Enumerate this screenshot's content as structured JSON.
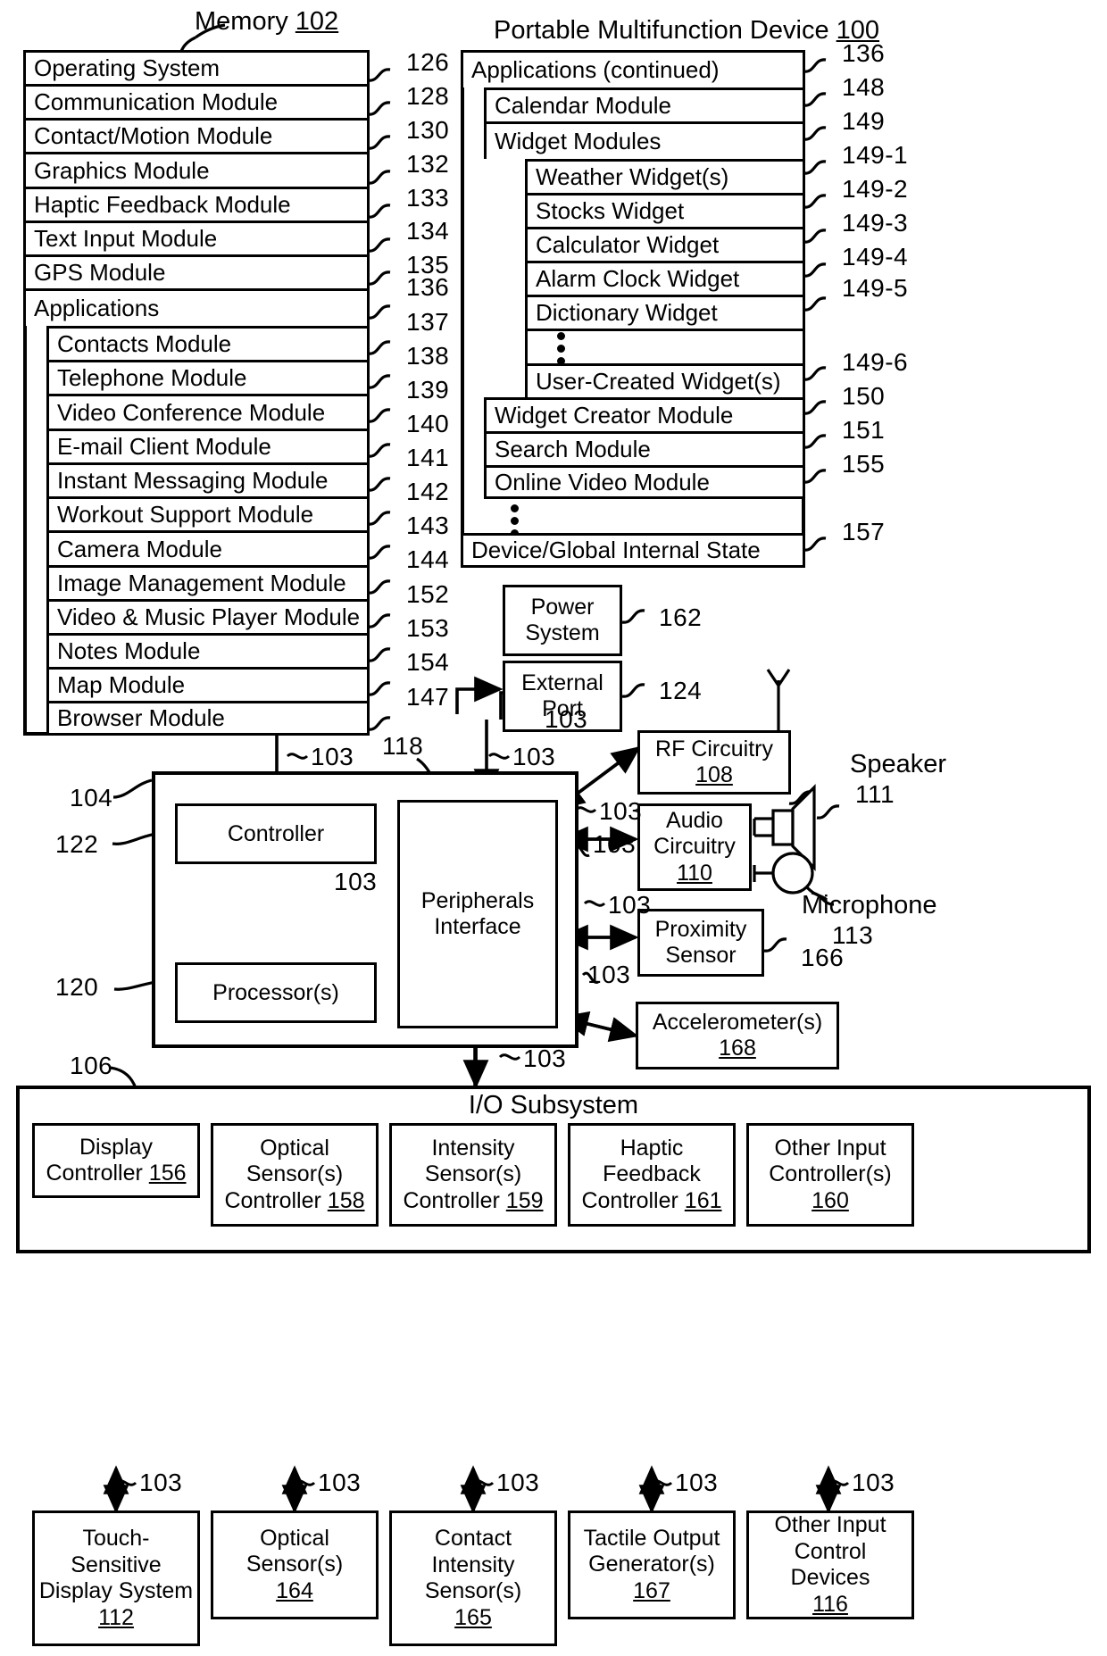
{
  "figure": {
    "memory_title": "Memory",
    "memory_ref": "102",
    "device_title": "Portable Multifunction Device",
    "device_ref": "100"
  },
  "memory_column": {
    "rows": [
      {
        "label": "Operating System",
        "ref": "126"
      },
      {
        "label": "Communication Module",
        "ref": "128"
      },
      {
        "label": "Contact/Motion Module",
        "ref": "130"
      },
      {
        "label": "Graphics Module",
        "ref": "132"
      },
      {
        "label": "Haptic Feedback Module",
        "ref": "133"
      },
      {
        "label": "Text Input Module",
        "ref": "134"
      },
      {
        "label": "GPS Module",
        "ref": "135"
      },
      {
        "label": "Applications",
        "ref": "136"
      }
    ],
    "applications": [
      {
        "label": "Contacts Module",
        "ref": "137"
      },
      {
        "label": "Telephone Module",
        "ref": "138"
      },
      {
        "label": "Video Conference Module",
        "ref": "139"
      },
      {
        "label": "E-mail Client Module",
        "ref": "140"
      },
      {
        "label": "Instant Messaging Module",
        "ref": "141"
      },
      {
        "label": "Workout Support Module",
        "ref": "142"
      },
      {
        "label": "Camera Module",
        "ref": "143"
      },
      {
        "label": "Image Management Module",
        "ref": "144"
      },
      {
        "label": "Video & Music Player Module",
        "ref": "152"
      },
      {
        "label": "Notes Module",
        "ref": "153"
      },
      {
        "label": "Map Module",
        "ref": "154"
      },
      {
        "label": "Browser Module",
        "ref": "147"
      }
    ]
  },
  "device_column": {
    "applications_continued": {
      "label": "Applications (continued)",
      "ref": "136"
    },
    "calendar": {
      "label": "Calendar Module",
      "ref": "148"
    },
    "widget_modules": {
      "label": "Widget Modules",
      "ref": "149"
    },
    "widgets": [
      {
        "label": "Weather Widget(s)",
        "ref": "149-1"
      },
      {
        "label": "Stocks Widget",
        "ref": "149-2"
      },
      {
        "label": "Calculator Widget",
        "ref": "149-3"
      },
      {
        "label": "Alarm Clock Widget",
        "ref": "149-4"
      },
      {
        "label": "Dictionary Widget",
        "ref": "149-5"
      }
    ],
    "user_created_widget": {
      "label": "User-Created Widget(s)",
      "ref": "149-6"
    },
    "tail_modules": [
      {
        "label": "Widget Creator Module",
        "ref": "150"
      },
      {
        "label": "Search Module",
        "ref": "151"
      },
      {
        "label": "Online Video Module",
        "ref": "155"
      }
    ],
    "device_state": {
      "label": "Device/Global Internal State",
      "ref": "157"
    }
  },
  "mid_blocks": {
    "power_system": {
      "line1": "Power",
      "line2": "System",
      "ref": "162"
    },
    "external_port": {
      "line1": "External",
      "line2": "Port",
      "ref": "124"
    },
    "rf_circuitry": {
      "line1": "RF Circuitry",
      "ref": "108"
    },
    "audio_circuitry": {
      "line1": "Audio",
      "line2": "Circuitry",
      "ref": "110"
    },
    "proximity_sensor": {
      "line1": "Proximity",
      "line2": "Sensor",
      "ref": "166"
    },
    "accelerometer": {
      "line1": "Accelerometer(s)",
      "ref": "168"
    },
    "speaker": {
      "label": "Speaker",
      "ref": "111"
    },
    "microphone": {
      "label": "Microphone",
      "ref": "113"
    },
    "controller": {
      "label": "Controller",
      "ref": "122"
    },
    "processors": {
      "label": "Processor(s)",
      "ref": "120"
    },
    "peripherals": {
      "line1": "Peripherals",
      "line2": "Interface",
      "ref": "118"
    },
    "cpu_group_ref": "104",
    "bus_ref": "103",
    "io_group_ref": "106"
  },
  "io_subsystem": {
    "title": "I/O Subsystem",
    "controllers": [
      {
        "line1": "Display",
        "line2": "Controller",
        "ref": "156"
      },
      {
        "line1": "Optical",
        "line2": "Sensor(s)",
        "line3": "Controller",
        "ref": "158"
      },
      {
        "line1": "Intensity",
        "line2": "Sensor(s)",
        "line3": "Controller",
        "ref": "159"
      },
      {
        "line1": "Haptic",
        "line2": "Feedback",
        "line3": "Controller",
        "ref": "161"
      },
      {
        "line1": "Other Input",
        "line2": "Controller(s)",
        "ref": "160"
      }
    ],
    "devices": [
      {
        "line1": "Touch-",
        "line2": "Sensitive",
        "line3": "Display System",
        "ref": "112"
      },
      {
        "line1": "Optical",
        "line2": "Sensor(s)",
        "ref": "164"
      },
      {
        "line1": "Contact",
        "line2": "Intensity",
        "line3": "Sensor(s)",
        "ref": "165"
      },
      {
        "line1": "Tactile Output",
        "line2": "Generator(s)",
        "ref": "167"
      },
      {
        "line1": "Other Input",
        "line2": "Control Devices",
        "ref": "116"
      }
    ],
    "bus_labels": [
      "103",
      "103",
      "103",
      "103",
      "103"
    ]
  }
}
